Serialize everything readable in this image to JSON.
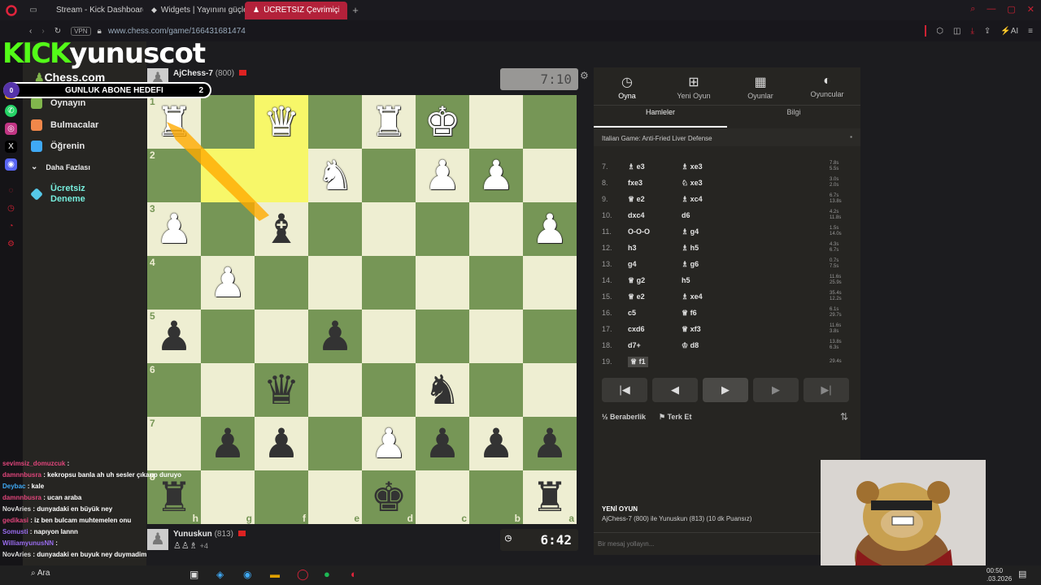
{
  "browser": {
    "tabs": [
      {
        "label": "Stream - Kick Dashboard",
        "active": false
      },
      {
        "label": "Widgets | Yayınını güçlend",
        "active": false
      },
      {
        "label": "ÜCRETSİZ Çevrimiçi Satra",
        "active": true
      }
    ],
    "vpn": "VPN",
    "url": "www.chess.com/game/166431681474",
    "ai": "AI"
  },
  "stream_overlay": {
    "brand": "KICK",
    "channel": "yunuscot",
    "goal_label": "GUNLUK ABONE HEDEFI",
    "goal_current": "0",
    "goal_target": "2"
  },
  "chess_nav": {
    "logo": "Chess.com",
    "items": [
      "Oynayın",
      "Bulmacalar",
      "Öğrenin",
      "Daha Fazlası",
      "Ücretsiz Deneme"
    ]
  },
  "top_player": {
    "name": "AjChess-7",
    "rating": "(800)",
    "clock": "7:10"
  },
  "bottom_player": {
    "name": "Yunuskun",
    "rating": "(813)",
    "clock": "6:42",
    "captures_extra": "+4"
  },
  "board": {
    "ranks": [
      "1",
      "2",
      "3",
      "4",
      "5",
      "6",
      "7",
      "8"
    ],
    "files": [
      "h",
      "g",
      "f",
      "e",
      "d",
      "c",
      "b",
      "a"
    ],
    "rows": [
      [
        "wR",
        "",
        "wQ",
        "",
        "wR",
        "wK",
        "",
        ""
      ],
      [
        "",
        "",
        "",
        "wN",
        "",
        "wP",
        "wP",
        ""
      ],
      [
        "wP",
        "",
        "bB",
        "",
        "",
        "",
        "",
        "wP"
      ],
      [
        "",
        "wP",
        "",
        "",
        "",
        "",
        "",
        ""
      ],
      [
        "bP",
        "",
        "",
        "bP",
        "",
        "",
        "",
        ""
      ],
      [
        "",
        "",
        "bQ",
        "",
        "",
        "bN",
        "",
        ""
      ],
      [
        "",
        "bP",
        "bP",
        "",
        "wP",
        "bP",
        "bP",
        "bP"
      ],
      [
        "bR",
        "",
        "",
        "",
        "bK",
        "",
        "",
        "bR"
      ]
    ],
    "highlight": [
      [
        0,
        2
      ],
      [
        1,
        1
      ],
      [
        1,
        2
      ]
    ]
  },
  "panel": {
    "tabs": [
      {
        "label": "Oyna",
        "icon": "clock-icon"
      },
      {
        "label": "Yeni Oyun",
        "icon": "plus-icon"
      },
      {
        "label": "Oyunlar",
        "icon": "board-icon"
      },
      {
        "label": "Oyuncular",
        "icon": "users-icon"
      }
    ],
    "subtabs": [
      "Hamleler",
      "Bilgi"
    ],
    "opening": "Italian Game: Anti-Fried Liver Defense",
    "moves": [
      {
        "n": "7.",
        "w": "♗ e3",
        "b": "♗ xe3",
        "tw": "7.8s",
        "tb": "5.5s"
      },
      {
        "n": "8.",
        "w": "fxe3",
        "b": "♘ xe3",
        "tw": "3.0s",
        "tb": "2.0s"
      },
      {
        "n": "9.",
        "w": "♕ e2",
        "b": "♗ xc4",
        "tw": "6.7s",
        "tb": "13.8s"
      },
      {
        "n": "10.",
        "w": "dxc4",
        "b": "d6",
        "tw": "4.2s",
        "tb": "11.8s"
      },
      {
        "n": "11.",
        "w": "O-O-O",
        "b": "♗ g4",
        "tw": "1.5s",
        "tb": "14.0s"
      },
      {
        "n": "12.",
        "w": "h3",
        "b": "♗ h5",
        "tw": "4.3s",
        "tb": "6.7s"
      },
      {
        "n": "13.",
        "w": "g4",
        "b": "♗ g6",
        "tw": "0.7s",
        "tb": "7.5s"
      },
      {
        "n": "14.",
        "w": "♕ g2",
        "b": "h5",
        "tw": "11.6s",
        "tb": "25.9s"
      },
      {
        "n": "15.",
        "w": "♕ e2",
        "b": "♗ xe4",
        "tw": "35.4s",
        "tb": "12.2s"
      },
      {
        "n": "16.",
        "w": "c5",
        "b": "♕ f6",
        "tw": "6.1s",
        "tb": "29.7s"
      },
      {
        "n": "17.",
        "w": "cxd6",
        "b": "♕ xf3",
        "tw": "11.6s",
        "tb": "3.8s"
      },
      {
        "n": "18.",
        "w": "d7+",
        "b": "♔ d8",
        "tw": "13.8s",
        "tb": "6.3s"
      },
      {
        "n": "19.",
        "w": "♕ f1",
        "b": "",
        "tw": "29.4s",
        "tb": ""
      }
    ],
    "draw_label": "Beraberlik",
    "resign_label": "Terk Et",
    "new_game_title": "YENİ OYUN",
    "new_game_desc": "AjChess-7 (800) ile Yunuskun (813) (10 dk Puansız)",
    "chat_placeholder": "Bir mesaj yollayın..."
  },
  "chat_messages": [
    {
      "user": "sevimsiz_domuzcuk",
      "text": "",
      "color": "#e0457b"
    },
    {
      "user": "damnnbusra",
      "text": "kekropsu banla ah uh sesler çıkarıp duruyo",
      "color": "#e0457b"
    },
    {
      "user": "Deybac",
      "text": "kale",
      "color": "#3fa9f5"
    },
    {
      "user": "damnnbusra",
      "text": "ucan araba",
      "color": "#e0457b"
    },
    {
      "user": "NovAries",
      "text": "dunyadaki en büyük ney",
      "color": "#ddd"
    },
    {
      "user": "gedikasi",
      "text": "iz ben bulcam muhtemelen onu",
      "color": "#e0457b"
    },
    {
      "user": "Somusti",
      "text": "napıyon lannn",
      "color": "#9a6cf0"
    },
    {
      "user": "WilliamyunusNN",
      "text": "",
      "color": "#9a6cf0"
    },
    {
      "user": "NovAries",
      "text": "dunyadaki en buyuk ney duymadim",
      "color": "#ddd"
    }
  ],
  "taskbar": {
    "search": "Ara",
    "time": "00:50",
    "date": ".03.2026"
  }
}
